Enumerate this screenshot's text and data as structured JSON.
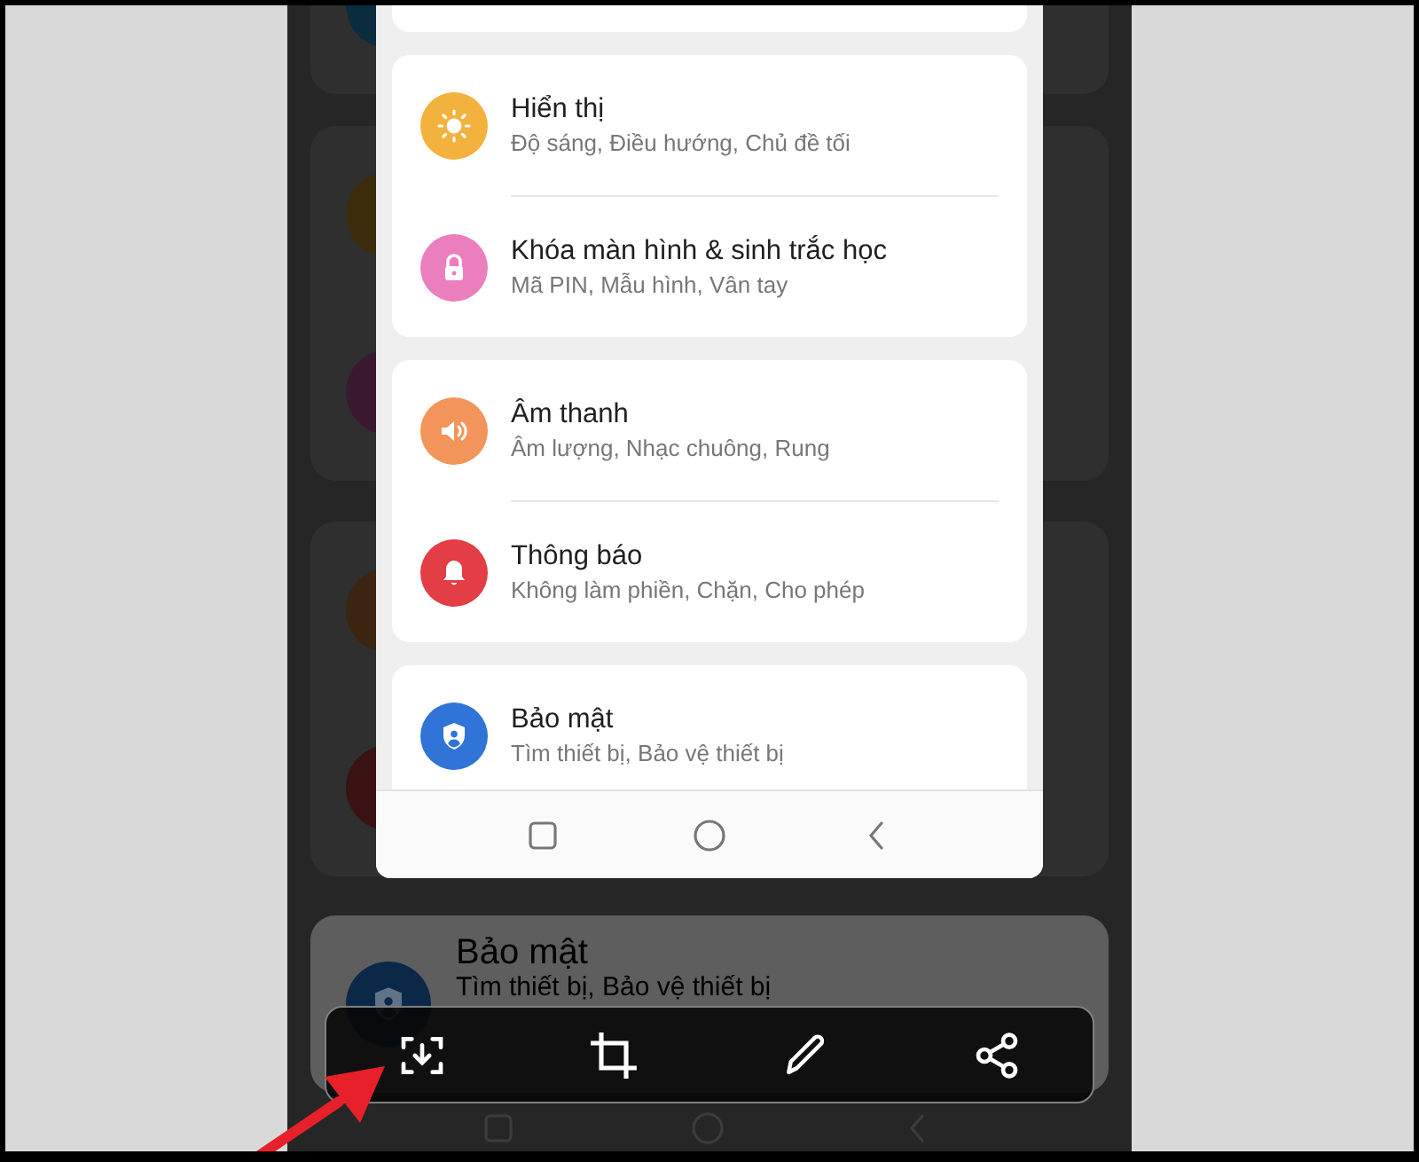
{
  "background": {
    "rows": [
      {
        "color": "#0b2c3e"
      },
      {
        "color": "#3b2c0c"
      },
      {
        "color": "#3a1930"
      },
      {
        "color": "#3b2410"
      },
      {
        "color": "#3a1212"
      },
      {
        "color": "#0c2848",
        "title": "Bảo mật",
        "subtitle": "Tìm thiết bị, Bảo vệ thiết bị"
      }
    ]
  },
  "preview": {
    "groups": [
      {
        "items": [
          {
            "kind": "sun",
            "color": "#f3b23e",
            "title": "Hiển thị",
            "subtitle": "Độ sáng, Điều hướng, Chủ đề tối"
          },
          {
            "kind": "lock",
            "color": "#eb7fbd",
            "title": "Khóa màn hình & sinh trắc học",
            "subtitle": "Mã PIN, Mẫu hình, Vân tay"
          }
        ]
      },
      {
        "items": [
          {
            "kind": "speaker",
            "color": "#f3955a",
            "title": "Âm thanh",
            "subtitle": "Âm lượng, Nhạc chuông, Rung"
          },
          {
            "kind": "bell",
            "color": "#e33d45",
            "title": "Thông báo",
            "subtitle": "Không làm phiền, Chặn, Cho phép"
          }
        ]
      },
      {
        "items": [
          {
            "kind": "shield",
            "color": "#2f74d6",
            "title": "Bảo mật",
            "subtitle": "Tìm thiết bị, Bảo vệ thiết bị"
          }
        ]
      }
    ]
  },
  "toolbar": {
    "buttons": [
      {
        "kind": "capture"
      },
      {
        "kind": "crop"
      },
      {
        "kind": "edit"
      },
      {
        "kind": "share"
      }
    ]
  }
}
